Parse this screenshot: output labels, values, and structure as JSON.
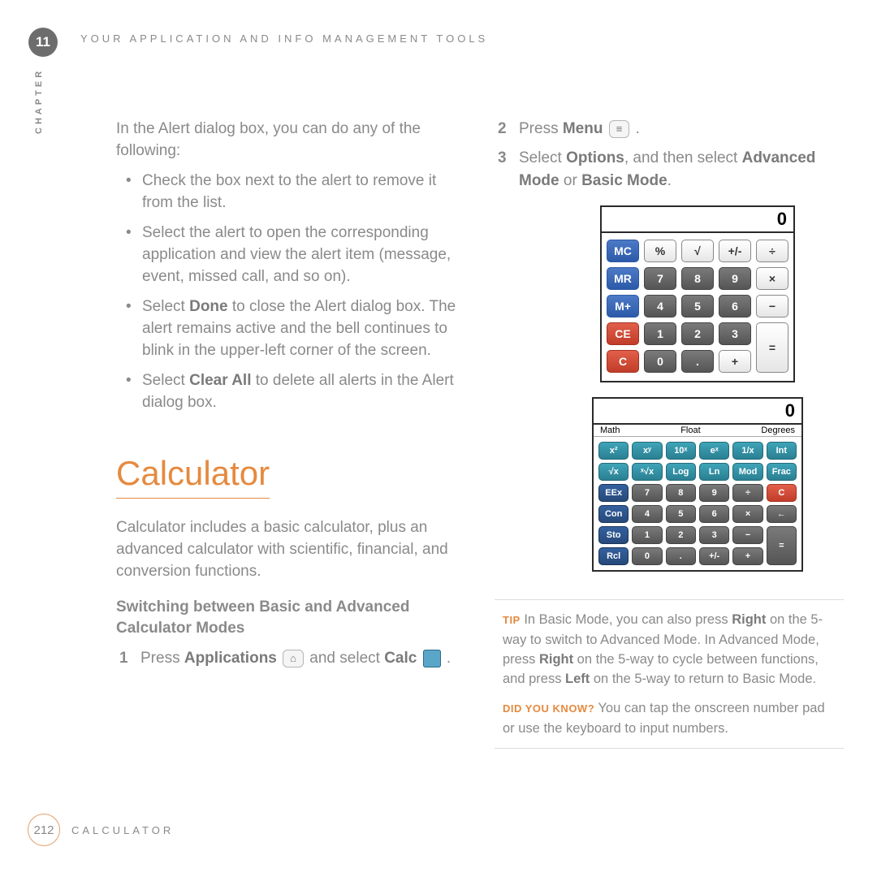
{
  "chapter": {
    "number": "11",
    "label": "CHAPTER"
  },
  "running_head": "YOUR APPLICATION AND INFO MANAGEMENT TOOLS",
  "left": {
    "intro": "In the Alert dialog box, you can do any of the following:",
    "bullets": {
      "b1": "Check the box next to the alert to remove it from the list.",
      "b2": "Select the alert to open the corresponding application and view the alert item (message, event, missed call, and so on).",
      "b3_pre": "Select ",
      "b3_bold": "Done",
      "b3_post": " to close the Alert dialog box. The alert remains active and the bell continues to blink in the upper-left corner of the screen.",
      "b4_pre": "Select ",
      "b4_bold": "Clear All",
      "b4_post": " to delete all alerts in the Alert dialog box."
    },
    "section_title": "Calculator",
    "section_intro": "Calculator includes a basic calculator, plus an advanced calculator with scientific, financial, and conversion functions.",
    "sub_heading": "Switching between Basic and Advanced Calculator Modes",
    "step1": {
      "pre": "Press ",
      "bold1": "Applications",
      "mid": " and select ",
      "bold2": "Calc",
      "post": " ."
    }
  },
  "right": {
    "step2": {
      "pre": "Press ",
      "bold": "Menu",
      "post": " ."
    },
    "step3": {
      "pre": "Select ",
      "b1": "Options",
      "mid": ", and then select ",
      "b2": "Advanced Mode",
      "mid2": " or ",
      "b3": "Basic Mode",
      "post": "."
    },
    "basic_calc": {
      "display": "0",
      "rows": [
        [
          "MC",
          "%",
          "√",
          "+/-",
          "÷"
        ],
        [
          "MR",
          "7",
          "8",
          "9",
          "×"
        ],
        [
          "M+",
          "4",
          "5",
          "6",
          "−"
        ],
        [
          "CE",
          "1",
          "2",
          "3",
          "="
        ],
        [
          "C",
          "0",
          ".",
          "+",
          ""
        ]
      ]
    },
    "adv_calc": {
      "display": "0",
      "modes": [
        "Math",
        "Float",
        "Degrees"
      ],
      "rows": [
        [
          "x²",
          "xʸ",
          "10ˣ",
          "eˣ",
          "1/x",
          "Int"
        ],
        [
          "√x",
          "ˣ√x",
          "Log",
          "Ln",
          "Mod",
          "Frac"
        ],
        [
          "EEx",
          "7",
          "8",
          "9",
          "÷",
          "C"
        ],
        [
          "Con",
          "4",
          "5",
          "6",
          "×",
          "←"
        ],
        [
          "Sto",
          "1",
          "2",
          "3",
          "−",
          "="
        ],
        [
          "Rcl",
          "0",
          ".",
          "+/-",
          "+",
          ""
        ]
      ]
    },
    "callout": {
      "tip_label": "TIP",
      "tip_text_pre": " In Basic Mode, you can also press ",
      "tip_b1": "Right",
      "tip_text_mid1": " on the 5-way to switch to Advanced Mode. In Advanced Mode, press ",
      "tip_b2": "Right",
      "tip_text_mid2": " on the 5-way to cycle between functions, and press ",
      "tip_b3": "Left",
      "tip_text_post": " on the 5-way to return to Basic Mode.",
      "dyk_label": "DID YOU KNOW?",
      "dyk_text": " You can tap the onscreen number pad or use the keyboard to input numbers."
    }
  },
  "footer": {
    "page": "212",
    "label": "CALCULATOR"
  }
}
